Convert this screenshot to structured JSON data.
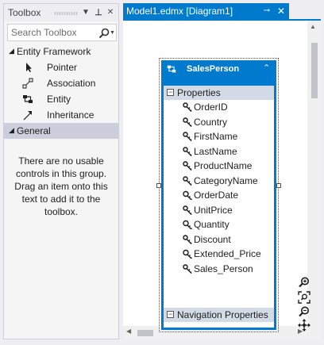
{
  "toolbox": {
    "title": "Toolbox",
    "dropdown_glyph": "▼",
    "pin_glyph": "⊥",
    "close_glyph": "✕",
    "search": {
      "placeholder": "Search Toolbox"
    },
    "categories": [
      {
        "label": "Entity Framework",
        "expanded": true,
        "items": [
          {
            "label": "Pointer",
            "icon": "pointer-icon"
          },
          {
            "label": "Association",
            "icon": "association-icon"
          },
          {
            "label": "Entity",
            "icon": "entity-icon"
          },
          {
            "label": "Inheritance",
            "icon": "inheritance-icon"
          }
        ]
      },
      {
        "label": "General",
        "expanded": true,
        "selected": true,
        "empty_message": "There are no usable controls in this group. Drag an item onto this text to add it to the toolbox."
      }
    ]
  },
  "document": {
    "tab_label": "Model1.edmx [Diagram1]",
    "pin_glyph": "⊸",
    "close_glyph": "✕"
  },
  "entity": {
    "name": "SalesPerson",
    "collapse_glyph": "⌃",
    "properties_label": "Properties",
    "navigation_label": "Navigation Properties",
    "properties": [
      {
        "name": "OrderID",
        "icon": "property-icon"
      },
      {
        "name": "Country",
        "icon": "property-icon"
      },
      {
        "name": "FirstName",
        "icon": "property-icon"
      },
      {
        "name": "LastName",
        "icon": "property-icon"
      },
      {
        "name": "ProductName",
        "icon": "property-icon"
      },
      {
        "name": "CategoryName",
        "icon": "property-icon"
      },
      {
        "name": "OrderDate",
        "icon": "key-icon"
      },
      {
        "name": "UnitPrice",
        "icon": "property-icon"
      },
      {
        "name": "Quantity",
        "icon": "key-icon"
      },
      {
        "name": "Discount",
        "icon": "property-icon"
      },
      {
        "name": "Extended_Price",
        "icon": "key-icon"
      },
      {
        "name": "Sales_Person",
        "icon": "property-icon"
      }
    ]
  },
  "colors": {
    "accent": "#007acc",
    "selected_category": "#cccedb",
    "section_header": "#d3dce6"
  }
}
